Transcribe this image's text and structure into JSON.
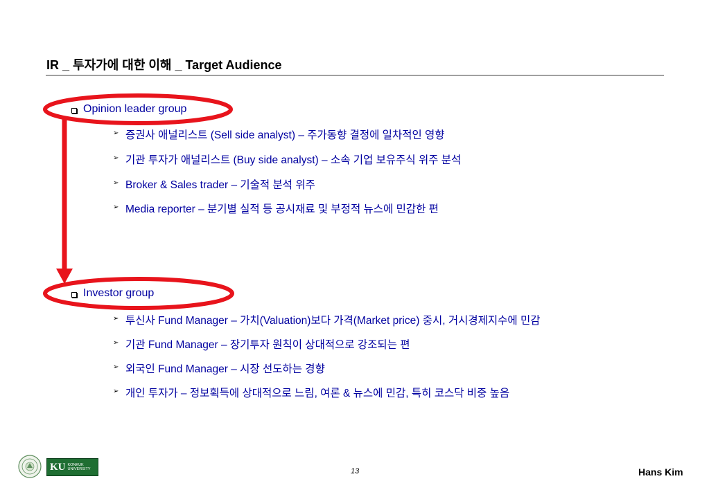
{
  "title": "IR _ 투자가에 대한 이해 _ Target Audience",
  "groups": [
    {
      "label": "Opinion leader group",
      "items": [
        "증권사 애널리스트 (Sell side analyst) – 주가동향 결정에 일차적인 영향",
        "기관 투자가 애널리스트 (Buy side analyst) – 소속 기업 보유주식 위주 분석",
        "Broker & Sales trader – 기술적 분석 위주",
        "Media reporter – 분기별 실적 등 공시재료 및 부정적 뉴스에 민감한 편"
      ]
    },
    {
      "label": "Investor group",
      "items": [
        "투신사 Fund Manager – 가치(Valuation)보다 가격(Market price) 중시, 거시경제지수에 민감",
        "기관 Fund Manager – 장기투자 원칙이 상대적으로 강조되는 편",
        "외국인 Fund Manager – 시장 선도하는 경향",
        "개인 투자가 – 정보획득에 상대적으로 느림, 여론 & 뉴스에 민감, 특히 코스닥 비중 높음"
      ]
    }
  ],
  "footer": {
    "page_number": "13",
    "author": "Hans Kim",
    "logo_text": "KU",
    "logo_sub_1": "KONKUK",
    "logo_sub_2": "UNIVERSITY"
  },
  "colors": {
    "highlight": "#e8141c",
    "text_blue": "#0000a0",
    "rule": "#a0a0a0",
    "logo_green": "#1f6e32"
  }
}
